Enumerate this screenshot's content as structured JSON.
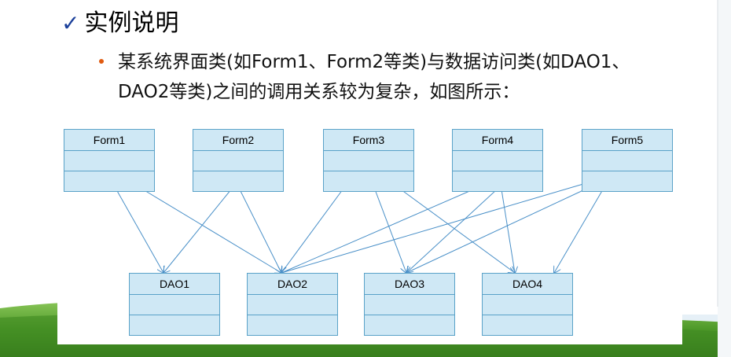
{
  "title": {
    "check_icon": "checkmark-icon",
    "text": "实例说明"
  },
  "bullet": {
    "line1": "某系统界面类(如Form1、Form2等类)与数据访问类(如DAO1、",
    "line2": "DAO2等类)之间的调用关系较为复杂，如图所示："
  },
  "diagram": {
    "forms": [
      "Form1",
      "Form2",
      "Form3",
      "Form4",
      "Form5"
    ],
    "daos": [
      "DAO1",
      "DAO2",
      "DAO3",
      "DAO4"
    ],
    "edges": [
      {
        "from": "Form1",
        "to": "DAO1"
      },
      {
        "from": "Form1",
        "to": "DAO2"
      },
      {
        "from": "Form2",
        "to": "DAO1"
      },
      {
        "from": "Form2",
        "to": "DAO2"
      },
      {
        "from": "Form3",
        "to": "DAO2"
      },
      {
        "from": "Form3",
        "to": "DAO3"
      },
      {
        "from": "Form3",
        "to": "DAO4"
      },
      {
        "from": "Form4",
        "to": "DAO2"
      },
      {
        "from": "Form4",
        "to": "DAO3"
      },
      {
        "from": "Form4",
        "to": "DAO4"
      },
      {
        "from": "Form5",
        "to": "DAO2"
      },
      {
        "from": "Form5",
        "to": "DAO3"
      },
      {
        "from": "Form5",
        "to": "DAO4"
      }
    ],
    "box_fill": "#cfe8f5",
    "box_border": "#5aa2c8",
    "arrow_color": "#4a90c8"
  },
  "theme": {
    "grass": "#4f9a2a",
    "sky": "#e8f1f7",
    "accent_orange": "#e05a10",
    "check_color": "#1a3f9a"
  }
}
